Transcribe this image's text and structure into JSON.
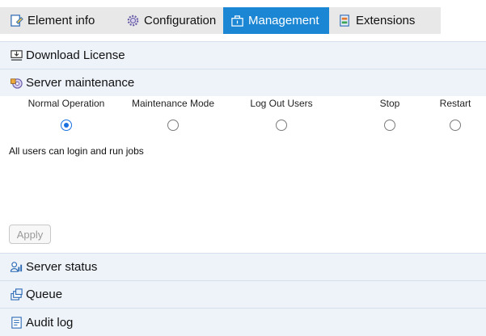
{
  "tabs": [
    {
      "label": "Element info",
      "icon": "element-info-icon",
      "active": false
    },
    {
      "label": "Configuration",
      "icon": "gear-icon",
      "active": false
    },
    {
      "label": "Management",
      "icon": "management-icon",
      "active": true
    },
    {
      "label": "Extensions",
      "icon": "extensions-icon",
      "active": false
    }
  ],
  "sections": {
    "download_license": {
      "label": "Download License",
      "icon": "download-license-icon"
    },
    "server_maintenance": {
      "label": "Server maintenance",
      "icon": "server-maintenance-icon"
    },
    "server_status": {
      "label": "Server status",
      "icon": "server-status-icon"
    },
    "queue": {
      "label": "Queue",
      "icon": "queue-icon"
    },
    "audit_log": {
      "label": "Audit log",
      "icon": "audit-log-icon"
    }
  },
  "maintenance": {
    "options": [
      {
        "label": "Normal Operation",
        "selected": true
      },
      {
        "label": "Maintenance Mode",
        "selected": false
      },
      {
        "label": "Log Out Users",
        "selected": false
      },
      {
        "label": "Stop",
        "selected": false
      },
      {
        "label": "Restart",
        "selected": false
      }
    ],
    "status_text": "All users can login and run jobs",
    "apply_label": "Apply"
  },
  "colors": {
    "accent": "#1a86d4",
    "tab_inactive": "#e8e8e8",
    "section_header": "#eef3fa",
    "radio_selected": "#1a6fe0"
  }
}
